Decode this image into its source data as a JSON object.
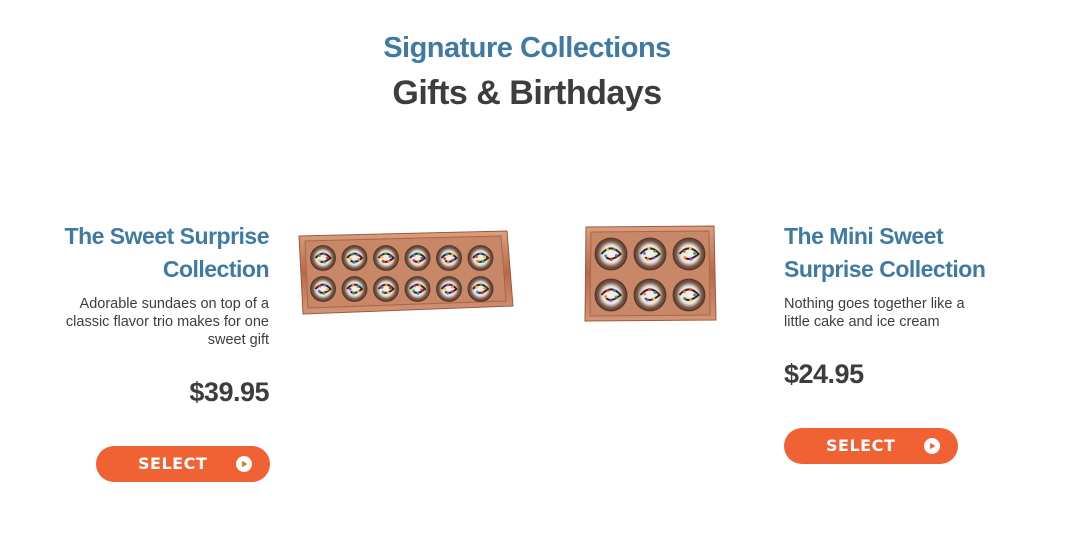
{
  "header": {
    "eyebrow": "Signature Collections",
    "title": "Gifts & Birthdays"
  },
  "products": [
    {
      "name_line1": "The Sweet Surprise",
      "name_line2": "Collection",
      "desc_lines": [
        "Adorable sundaes on top of a",
        "classic flavor trio makes for one",
        "sweet gift"
      ],
      "price": "$39.95",
      "select_label": "SELECT",
      "image": "sweet-surprise-tray-12"
    },
    {
      "name_line1": "The Mini Sweet",
      "name_line2": "Surprise Collection",
      "desc_lines": [
        "Nothing goes together like a",
        "little cake and ice cream"
      ],
      "price": "$24.95",
      "select_label": "SELECT",
      "image": "mini-sweet-surprise-tray-6"
    }
  ],
  "colors": {
    "accent_blue": "#3f7aa3",
    "text_dark": "#3d3d3d",
    "button_orange": "#f06133",
    "tray_copper": "#c9805f"
  },
  "icons": {
    "select_arrow": "play-circle-icon"
  }
}
